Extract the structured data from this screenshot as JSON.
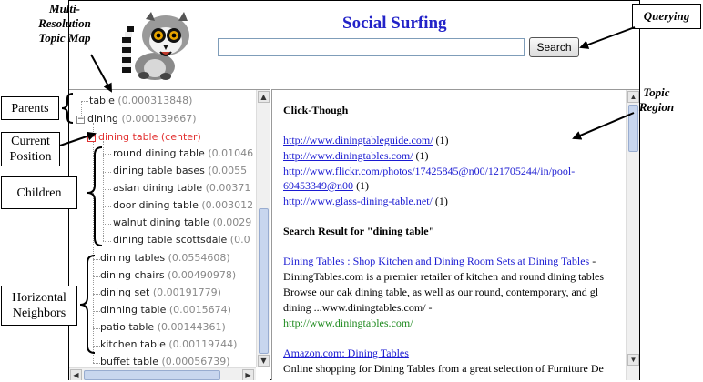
{
  "header": {
    "title": "Social Surfing",
    "search_value": "",
    "search_button": "Search"
  },
  "tree": {
    "parents": [
      {
        "label": "table",
        "score": "(0.000313848)"
      },
      {
        "label": "dining",
        "score": "(0.000139667)"
      }
    ],
    "current": {
      "label": "dining table (center)"
    },
    "children": [
      {
        "label": "round dining table",
        "score": "(0.01046"
      },
      {
        "label": "dining table bases",
        "score": "(0.0055"
      },
      {
        "label": "asian dining table",
        "score": "(0.00371"
      },
      {
        "label": "door dining table",
        "score": "(0.003012"
      },
      {
        "label": "walnut dining table",
        "score": "(0.0029"
      },
      {
        "label": "dining table scottsdale",
        "score": "(0.0"
      }
    ],
    "neighbors": [
      {
        "label": "dining tables",
        "score": "(0.0554608)"
      },
      {
        "label": "dining chairs",
        "score": "(0.00490978)"
      },
      {
        "label": "dining set",
        "score": "(0.00191779)"
      },
      {
        "label": "dinning table",
        "score": "(0.0015674)"
      },
      {
        "label": "patio table",
        "score": "(0.00144361)"
      },
      {
        "label": "kitchen table",
        "score": "(0.00119744)"
      },
      {
        "label": "buffet table",
        "score": "(0.00056739)"
      }
    ]
  },
  "topic_region": {
    "clickthrough_heading": "Click-Though",
    "clickthrough": [
      {
        "url": "http://www.diningtableguide.com/",
        "count": "(1)"
      },
      {
        "url": "http://www.diningtables.com/",
        "count": "(1)"
      },
      {
        "url": "http://www.flickr.com/photos/17425845@n00/121705244/in/pool-",
        "count": ""
      },
      {
        "url": "69453349@n00",
        "count": "(1)"
      },
      {
        "url": "http://www.glass-dining-table.net/",
        "count": "(1)"
      }
    ],
    "search_heading": "Search Result for \"dining table\"",
    "results": [
      {
        "title": "Dining Tables : Shop Kitchen and Dining Room Sets at Dining Tables",
        "title_suffix": "-",
        "lines": [
          "DiningTables.com is a premier retailer of kitchen and round dining tables",
          "Browse our oak dining table, as well as our round, contemporary, and gl",
          "dining ...www.diningtables.com/ -"
        ],
        "url": "http://www.diningtables.com/"
      },
      {
        "title": "Amazon.com: Dining Tables",
        "lines": [
          "Online shopping for Dining Tables from a great selection of Furniture De"
        ]
      }
    ]
  },
  "annotations": {
    "topic_map": "Multi-Resolution Topic Map",
    "querying": "Querying",
    "topic_region": "Topic Region",
    "parents": "Parents",
    "current_position": "Current Position",
    "children": "Children",
    "horizontal_neighbors": "Horizontal Neighbors"
  },
  "icons": {
    "logo": "lemur-logo",
    "collapse": "minus-toggle-icon"
  }
}
